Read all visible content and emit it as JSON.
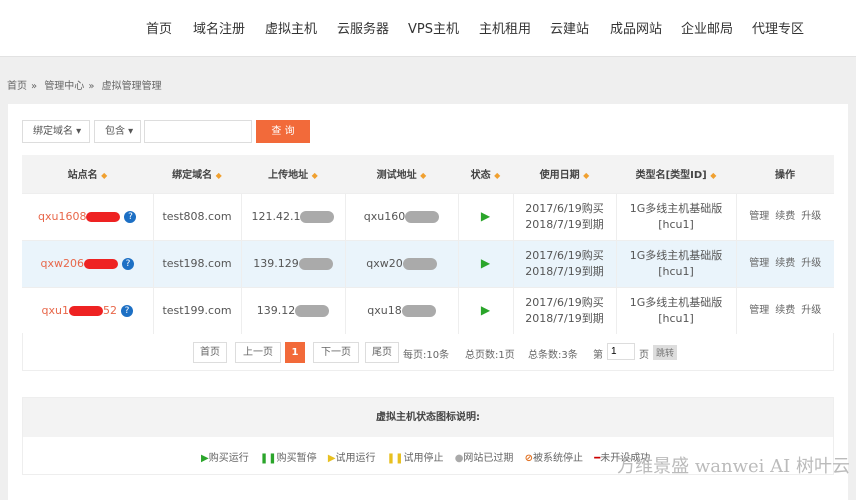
{
  "nav": [
    "首页",
    "域名注册",
    "虚拟主机",
    "云服务器",
    "VPS主机",
    "主机租用",
    "云建站",
    "成品网站",
    "企业邮局",
    "代理专区"
  ],
  "breadcrumb": [
    "首页",
    "管理中心",
    "虚拟管理管理"
  ],
  "search": {
    "field": "绑定域名",
    "match": "包含",
    "value": "",
    "button": "查 询"
  },
  "table": {
    "headers": [
      "站点名",
      "绑定域名",
      "上传地址",
      "测试地址",
      "状态",
      "使用日期",
      "类型名[类型ID]",
      "操作"
    ],
    "rows": [
      {
        "site": "qxu1608",
        "domain": "test808.com",
        "upload": "121.42.1",
        "test": "qxu160",
        "buy": "2017/6/19购买",
        "expire": "2018/7/19到期",
        "type": "1G多线主机基础版",
        "type_id": "[hcu1]"
      },
      {
        "site": "qxw206",
        "domain": "test198.com",
        "upload": "139.129",
        "test": "qxw20",
        "buy": "2017/6/19购买",
        "expire": "2018/7/19到期",
        "type": "1G多线主机基础版",
        "type_id": "[hcu1]"
      },
      {
        "site": "qxu1",
        "site_tail": "52",
        "domain": "test199.com",
        "upload": "139.12",
        "test": "qxu18",
        "buy": "2017/6/19购买",
        "expire": "2018/7/19到期",
        "type": "1G多线主机基础版",
        "type_id": "[hcu1]"
      }
    ],
    "ops": [
      "管理",
      "续费",
      "升级"
    ]
  },
  "pager": {
    "first": "首页",
    "prev": "上一页",
    "current": "1",
    "next": "下一页",
    "last": "尾页",
    "per_page": "每页:10条",
    "total_pages": "总页数:1页",
    "total": "总条数:3条",
    "goto_prefix": "第",
    "goto_value": "1",
    "goto_suffix": "页",
    "goto_btn": "跳转"
  },
  "legend": {
    "title": "虚拟主机状态图标说明:",
    "items": [
      "购买运行",
      "购买暂停",
      "试用运行",
      "试用停止",
      "网站已过期",
      "被系统停止",
      "未开设成功"
    ]
  },
  "watermark": "万维景盛 wanwei  AI 树叶云"
}
